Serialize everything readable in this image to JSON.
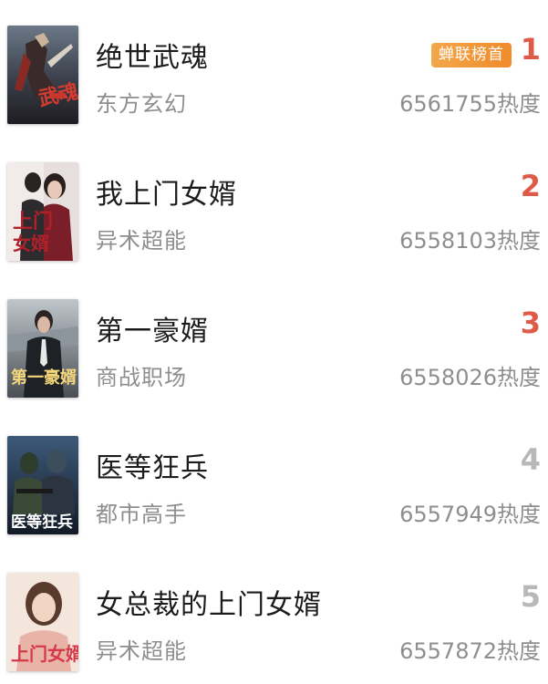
{
  "ranking": {
    "heat_unit": "热度",
    "items": [
      {
        "title": "绝世武魂",
        "genre": "东方玄幻",
        "rank": "1",
        "heat": "6561755",
        "badge": "蝉联榜首",
        "rank_color": "#e05a48",
        "cover_icon": "warrior-cover"
      },
      {
        "title": "我上门女婿",
        "genre": "异术超能",
        "rank": "2",
        "heat": "6558103",
        "rank_color": "#e05a48",
        "cover_icon": "couple-cover"
      },
      {
        "title": "第一豪婿",
        "genre": "商战职场",
        "rank": "3",
        "heat": "6558026",
        "rank_color": "#e05a48",
        "cover_icon": "businessman-cover"
      },
      {
        "title": "医等狂兵",
        "genre": "都市高手",
        "rank": "4",
        "heat": "6557949",
        "rank_color": "#b8b8b8",
        "cover_icon": "soldier-cover"
      },
      {
        "title": "女总裁的上门女婿",
        "genre": "异术超能",
        "rank": "5",
        "heat": "6557872",
        "rank_color": "#b8b8b8",
        "cover_icon": "woman-cover"
      }
    ]
  }
}
